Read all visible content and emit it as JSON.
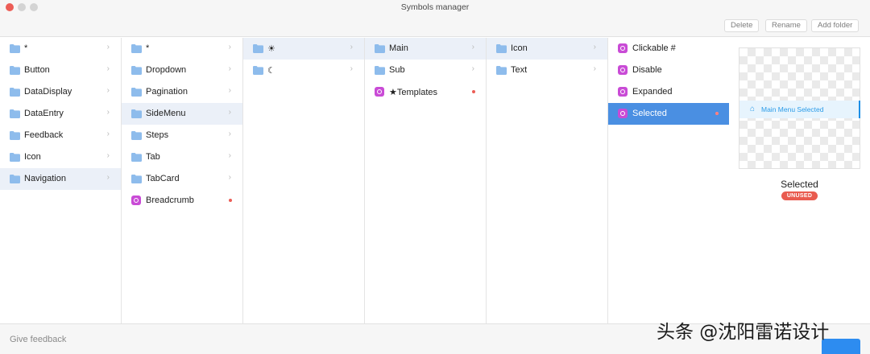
{
  "window": {
    "title": "Symbols manager"
  },
  "toolbar": {
    "delete_label": "Delete",
    "rename_label": "Rename",
    "add_folder_label": "Add folder"
  },
  "columns": [
    {
      "items": [
        {
          "label": "*",
          "type": "folder",
          "chevron": "›",
          "selected": false
        },
        {
          "label": "Button",
          "type": "folder",
          "chevron": "›",
          "selected": false
        },
        {
          "label": "DataDisplay",
          "type": "folder",
          "chevron": "›",
          "selected": false
        },
        {
          "label": "DataEntry",
          "type": "folder",
          "chevron": "›",
          "selected": false
        },
        {
          "label": "Feedback",
          "type": "folder",
          "chevron": "›",
          "selected": false
        },
        {
          "label": "Icon",
          "type": "folder",
          "chevron": "›",
          "selected": false
        },
        {
          "label": "Navigation",
          "type": "folder",
          "chevron": "›",
          "selected": true
        }
      ]
    },
    {
      "items": [
        {
          "label": "*",
          "type": "folder",
          "chevron": "›",
          "selected": false
        },
        {
          "label": "Dropdown",
          "type": "folder",
          "chevron": "›",
          "selected": false
        },
        {
          "label": "Pagination",
          "type": "folder",
          "chevron": "›",
          "selected": false
        },
        {
          "label": "SideMenu",
          "type": "folder",
          "chevron": "›",
          "selected": true
        },
        {
          "label": "Steps",
          "type": "folder",
          "chevron": "›",
          "selected": false
        },
        {
          "label": "Tab",
          "type": "folder",
          "chevron": "›",
          "selected": false
        },
        {
          "label": "TabCard",
          "type": "folder",
          "chevron": "›",
          "selected": false
        },
        {
          "label": "Breadcrumb",
          "type": "symbol",
          "unused": true,
          "selected": false
        }
      ]
    },
    {
      "items": [
        {
          "label": "☀",
          "type": "folder",
          "chevron": "›",
          "selected": true
        },
        {
          "label": "☾",
          "type": "folder",
          "chevron": "›",
          "selected": false
        }
      ]
    },
    {
      "items": [
        {
          "label": "Main",
          "type": "folder",
          "chevron": "›",
          "selected": true
        },
        {
          "label": "Sub",
          "type": "folder",
          "chevron": "›",
          "selected": false
        },
        {
          "label": "★Templates",
          "type": "symbol",
          "unused": true,
          "selected": false
        }
      ]
    },
    {
      "items": [
        {
          "label": "Icon",
          "type": "folder",
          "chevron": "›",
          "selected": true
        },
        {
          "label": "Text",
          "type": "folder",
          "chevron": "›",
          "selected": false
        }
      ]
    },
    {
      "items": [
        {
          "label": "Clickable #",
          "type": "symbol",
          "unused": false,
          "selected": false
        },
        {
          "label": "Disable",
          "type": "symbol",
          "unused": false,
          "selected": false
        },
        {
          "label": "Expanded",
          "type": "symbol",
          "unused": false,
          "selected": false
        },
        {
          "label": "Selected",
          "type": "symbol",
          "unused": true,
          "selected": true,
          "active": true
        }
      ]
    }
  ],
  "preview": {
    "menu_item_label": "Main Menu Selected",
    "menu_item_icon": "home-icon",
    "symbol_name": "Selected",
    "status_badge": "UNUSED"
  },
  "footer": {
    "feedback_label": "Give feedback"
  },
  "watermark": {
    "text": "头条 @沈阳雷诺设计"
  },
  "colors": {
    "accent": "#4a8fe2",
    "selection_light": "#ebf0f8",
    "symbol_icon": "#c94bd6",
    "unused_badge": "#e95b4f",
    "folder": "#8ebcec",
    "preview_accent": "#1d8fe6"
  }
}
